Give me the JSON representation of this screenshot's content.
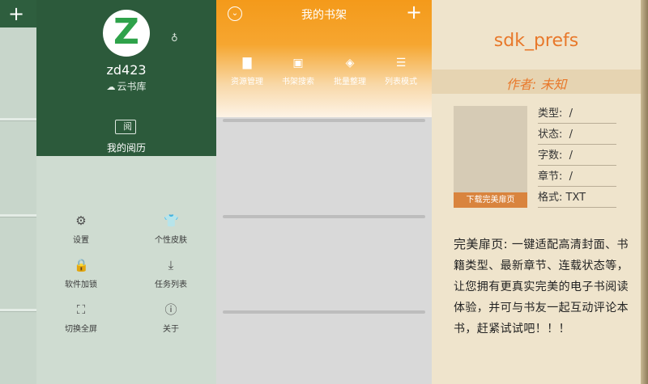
{
  "drawer": {
    "username": "zd423",
    "logo_letter": "Z",
    "cloud_library": "云书库",
    "history_icon_char": "阅",
    "history_label": "我的阅历",
    "menu": [
      {
        "label": "设置",
        "icon": "gear-icon"
      },
      {
        "label": "个性皮肤",
        "icon": "shirt-icon"
      },
      {
        "label": "软件加锁",
        "icon": "lock-icon"
      },
      {
        "label": "任务列表",
        "icon": "download-icon"
      },
      {
        "label": "切换全屏",
        "icon": "fullscreen-icon"
      },
      {
        "label": "关于",
        "icon": "info-icon"
      }
    ]
  },
  "shelf": {
    "title": "我的书架",
    "tools": [
      {
        "label": "资源管理",
        "icon": "folder-icon"
      },
      {
        "label": "书架搜索",
        "icon": "search-book-icon"
      },
      {
        "label": "批量整理",
        "icon": "layers-icon"
      },
      {
        "label": "列表模式",
        "icon": "list-icon"
      }
    ]
  },
  "book": {
    "title": "sdk_prefs",
    "author": "作者: 未知",
    "cover_button": "下载完美扉页",
    "meta": [
      {
        "label": "类型:",
        "value": "/"
      },
      {
        "label": "状态:",
        "value": "/"
      },
      {
        "label": "字数:",
        "value": "/"
      },
      {
        "label": "章节:",
        "value": "/"
      },
      {
        "label": "格式:",
        "value": "TXT"
      }
    ],
    "desc_lead": "完美扉页:",
    "desc_body": "一键适配高清封面、书籍类型、最新章节、连载状态等，让您拥有更真实完美的电子书阅读体验，并可与书友一起互动评论本书，赶紧试试吧！！！"
  },
  "colors": {
    "drawer_green": "#2c5a3b",
    "logo_green": "#2ea24a",
    "shelf_orange": "#f49a1a",
    "book_accent": "#e8782a"
  }
}
